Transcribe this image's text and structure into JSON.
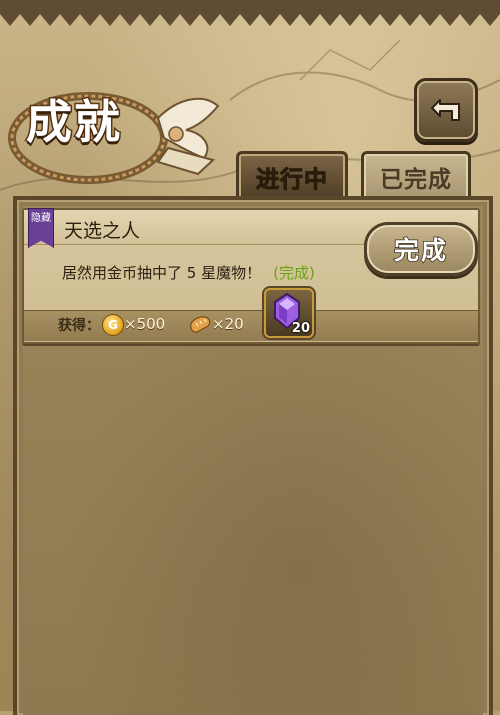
{
  "header": {
    "title": "成就",
    "back_icon": "return-arrow-icon"
  },
  "tabs": [
    {
      "label": "进行中",
      "active": true
    },
    {
      "label": "已完成",
      "active": false
    }
  ],
  "achievement": {
    "badge": "隐藏",
    "title": "天选之人",
    "description": "居然用金币抽中了 5 星魔物！",
    "status": "(完成)",
    "button_label": "完成",
    "rewards_label": "获得：",
    "rewards": [
      {
        "icon": "gold-coin-icon",
        "coin_symbol": "G",
        "amount": "×500"
      },
      {
        "icon": "bread-icon",
        "amount": "×20"
      },
      {
        "icon": "purple-gem-icon",
        "amount": "20"
      }
    ]
  },
  "colors": {
    "status_complete": "#6aa21a",
    "hidden_badge": "#6a3f96",
    "parchment": "#c9b488"
  }
}
